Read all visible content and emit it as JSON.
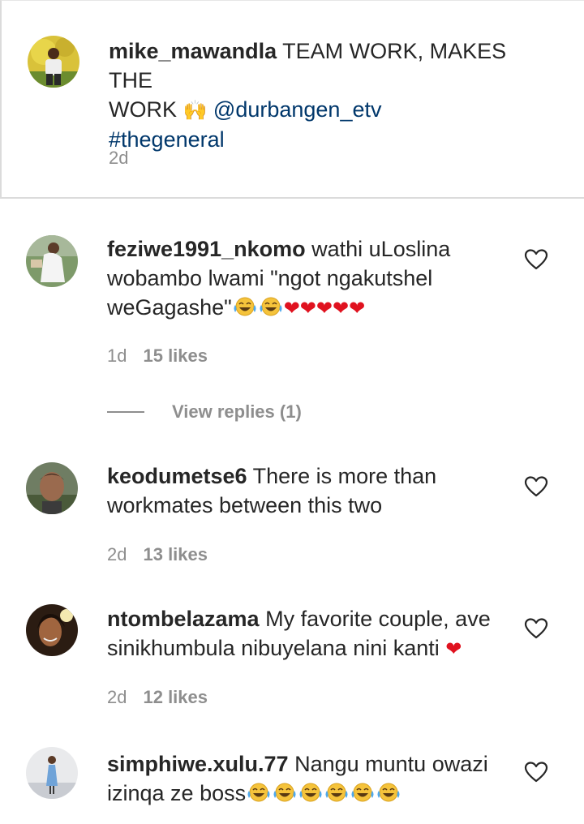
{
  "caption": {
    "username": "mike_mawandla",
    "text_line1": "TEAM WORK, MAKES THE",
    "text_line2_start": "WORK",
    "hands_emoji": "🙌",
    "mention": "@durbangen_etv",
    "hashtag": "#thegeneral",
    "time": "2d"
  },
  "comments": [
    {
      "username": "feziwe1991_nkomo",
      "text": "wathi uLoslina wobambo lwami \"ngot ngakutshel weGagashe\"",
      "emoji_laugh_count": 2,
      "hearts": "❤❤❤❤❤",
      "time": "1d",
      "likes": "15 likes",
      "view_replies": "View replies (1)"
    },
    {
      "username": "keodumetse6",
      "text": "There is more than workmates between this two",
      "time": "2d",
      "likes": "13 likes"
    },
    {
      "username": "ntombelazama",
      "text": "My favorite couple, ave sinikhumbula nibuyelana nini kanti",
      "hearts": "❤",
      "time": "2d",
      "likes": "12 likes"
    },
    {
      "username": "simphiwe.xulu.77",
      "text": "Nangu muntu owazi izinqa ze boss",
      "emoji_laugh_count": 6
    }
  ],
  "colors": {
    "text": "#262626",
    "secondary": "#8e8e8e",
    "link": "#00376b",
    "heart": "#e0121f",
    "divider": "#dbdbdb"
  },
  "icons": {
    "like": "heart-outline-icon",
    "laugh": "face-with-tears-of-joy-icon"
  }
}
